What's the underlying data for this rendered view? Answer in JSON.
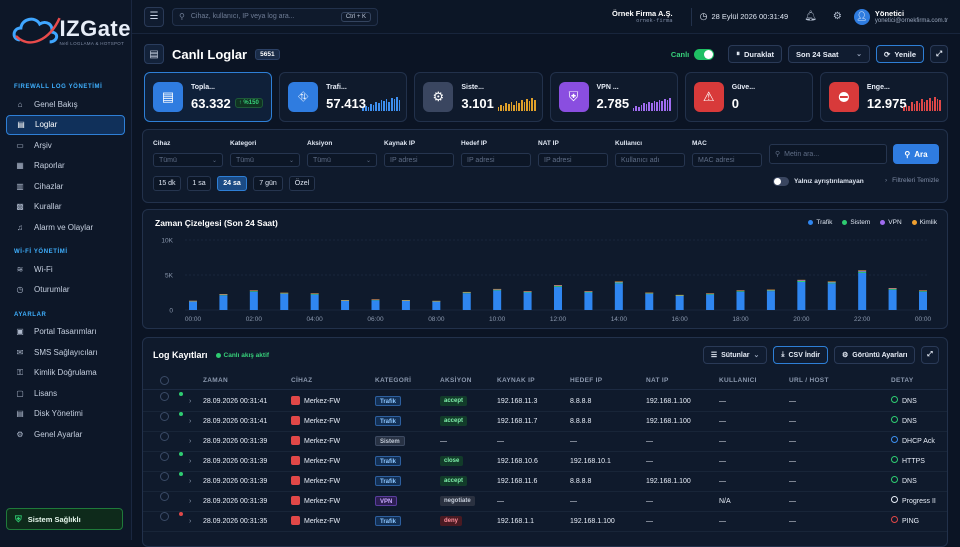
{
  "brand": {
    "name": "IZGate",
    "tagline": "Netl LOGLAMA & HOTSPOT"
  },
  "sidebar": {
    "sections": [
      {
        "title": "FIREWALL LOG YÖNETİMİ",
        "items": [
          {
            "label": "Genel Bakış",
            "icon": "home-icon",
            "active": false
          },
          {
            "label": "Loglar",
            "icon": "document-icon",
            "active": true
          },
          {
            "label": "Arşiv",
            "icon": "archive-icon",
            "active": false
          },
          {
            "label": "Raporlar",
            "icon": "report-icon",
            "active": false
          },
          {
            "label": "Cihazlar",
            "icon": "server-icon",
            "active": false
          },
          {
            "label": "Kurallar",
            "icon": "rules-icon",
            "active": false
          },
          {
            "label": "Alarm ve Olaylar",
            "icon": "bell-icon",
            "active": false
          }
        ]
      },
      {
        "title": "Wİ-Fİ YÖNETİMİ",
        "items": [
          {
            "label": "Wi-Fi",
            "icon": "wifi-icon",
            "active": false
          },
          {
            "label": "Oturumlar",
            "icon": "clock-icon",
            "active": false
          }
        ]
      },
      {
        "title": "AYARLAR",
        "items": [
          {
            "label": "Portal Tasarımları",
            "icon": "portal-icon",
            "active": false
          },
          {
            "label": "SMS Sağlayıcıları",
            "icon": "sms-icon",
            "active": false
          },
          {
            "label": "Kimlik Doğrulama",
            "icon": "key-icon",
            "active": false
          },
          {
            "label": "Lisans",
            "icon": "license-icon",
            "active": false
          },
          {
            "label": "Disk Yönetimi",
            "icon": "disk-icon",
            "active": false
          },
          {
            "label": "Genel Ayarlar",
            "icon": "gear-icon",
            "active": false
          }
        ]
      }
    ],
    "health": "Sistem Sağlıklı"
  },
  "topbar": {
    "search_placeholder": "Cihaz, kullanıcı, IP veya log ara...",
    "shortcut": "Ctrl + K",
    "company_name": "Örnek Firma A.Ş.",
    "company_domain": "ornek-firma",
    "datetime": "28 Eylül 2026 00:31:49",
    "user_name": "Yönetici",
    "user_email": "yonetici@ornekfirma.com.tr"
  },
  "page": {
    "title": "Canlı Loglar",
    "count": "5651",
    "live_label": "Canlı",
    "pause_label": "Duraklat",
    "range": "Son 24 Saat",
    "refresh_label": "Yenile"
  },
  "cards": [
    {
      "label": "Topla...",
      "value": "63.332",
      "delta": "↑ %150",
      "icon": "document-icon",
      "color": "#2f7ce0",
      "spark_color": "",
      "spark": []
    },
    {
      "label": "Trafi...",
      "value": "57.413",
      "delta": "",
      "icon": "network-icon",
      "color": "#2f7ce0",
      "spark_color": "#3d8ff0",
      "spark": [
        3,
        5,
        4,
        7,
        6,
        9,
        8,
        11,
        10,
        12,
        9,
        13,
        12,
        14,
        11
      ]
    },
    {
      "label": "Siste...",
      "value": "3.101",
      "delta": "",
      "icon": "gear-icon",
      "color": "#3a4660",
      "spark_color": "#e0a02a",
      "spark": [
        4,
        6,
        5,
        8,
        7,
        9,
        6,
        10,
        8,
        11,
        9,
        12,
        10,
        13,
        11
      ]
    },
    {
      "label": "VPN ...",
      "value": "2.785",
      "delta": "",
      "icon": "shield-icon",
      "color": "#8a4ee0",
      "spark_color": "#a06cf0",
      "spark": [
        3,
        5,
        4,
        6,
        8,
        7,
        9,
        8,
        10,
        9,
        11,
        10,
        12,
        11,
        13
      ]
    },
    {
      "label": "Güve...",
      "value": "0",
      "delta": "",
      "icon": "warning-icon",
      "color": "#d83a3a",
      "spark_color": "",
      "spark": []
    },
    {
      "label": "Enge...",
      "value": "12.975",
      "delta": "",
      "icon": "block-icon",
      "color": "#d83a3a",
      "spark_color": "#e04848",
      "spark": [
        4,
        6,
        5,
        9,
        7,
        10,
        8,
        12,
        9,
        11,
        13,
        10,
        14,
        12,
        11
      ]
    }
  ],
  "filters": {
    "fields": [
      {
        "label": "Cihaz",
        "value": "Tümü",
        "type": "select"
      },
      {
        "label": "Kategori",
        "value": "Tümü",
        "type": "select"
      },
      {
        "label": "Aksiyon",
        "value": "Tümü",
        "type": "select"
      },
      {
        "label": "Kaynak IP",
        "value": "IP adresi",
        "type": "input"
      },
      {
        "label": "Hedef IP",
        "value": "IP adresi",
        "type": "input"
      },
      {
        "label": "NAT IP",
        "value": "IP adresi",
        "type": "input"
      },
      {
        "label": "Kullanıcı",
        "value": "Kullanıcı adı",
        "type": "input"
      },
      {
        "label": "MAC",
        "value": "MAC adresi",
        "type": "input"
      }
    ],
    "text_search_placeholder": "Metin ara...",
    "search_button": "Ara",
    "quick_ranges": [
      "15 dk",
      "1 sa",
      "24 sa",
      "7 gün",
      "Özel"
    ],
    "active_range": "24 sa",
    "unparsed_label": "Yalnız ayrıştırılamayan",
    "clear_label": "Filtreleri Temizle"
  },
  "chart_data": {
    "type": "bar",
    "title": "Zaman Çizelgesi (Son 24 Saat)",
    "xlabel": "",
    "ylabel": "",
    "ylim": [
      0,
      10000
    ],
    "y_ticks": [
      "10K",
      "5K",
      "0"
    ],
    "x_ticks": [
      "00:00",
      "02:00",
      "04:00",
      "06:00",
      "08:00",
      "10:00",
      "12:00",
      "14:00",
      "16:00",
      "18:00",
      "20:00",
      "22:00",
      "00:00"
    ],
    "categories": [
      "00",
      "01",
      "02",
      "03",
      "04",
      "05",
      "06",
      "07",
      "08",
      "09",
      "10",
      "11",
      "12",
      "13",
      "14",
      "15",
      "16",
      "17",
      "18",
      "19",
      "20",
      "21",
      "22",
      "23",
      "24"
    ],
    "legend_position": "top-right",
    "series": [
      {
        "name": "Trafik",
        "color": "#2f86f0",
        "values": [
          1200,
          2100,
          2600,
          2300,
          2200,
          1300,
          1400,
          1300,
          1200,
          2400,
          2800,
          2500,
          3300,
          2500,
          3800,
          2300,
          2000,
          2200,
          2600,
          2700,
          4000,
          3800,
          5300,
          2900,
          2600
        ]
      },
      {
        "name": "Sistem",
        "color": "#2ecc71",
        "values": [
          60,
          90,
          100,
          80,
          90,
          60,
          60,
          60,
          50,
          90,
          100,
          90,
          120,
          90,
          130,
          90,
          80,
          90,
          100,
          100,
          150,
          130,
          180,
          110,
          100
        ]
      },
      {
        "name": "VPN",
        "color": "#a06cf0",
        "values": [
          40,
          60,
          70,
          60,
          60,
          40,
          40,
          40,
          40,
          60,
          70,
          60,
          80,
          60,
          90,
          60,
          50,
          60,
          70,
          70,
          100,
          90,
          120,
          80,
          70
        ]
      },
      {
        "name": "Kimlik",
        "color": "#f0a030",
        "values": [
          20,
          30,
          40,
          30,
          30,
          20,
          20,
          20,
          20,
          30,
          40,
          30,
          50,
          30,
          50,
          30,
          30,
          30,
          40,
          40,
          60,
          50,
          80,
          40,
          40
        ]
      }
    ]
  },
  "logs": {
    "title": "Log Kayıtları",
    "live_label": "Canlı akış aktif",
    "columns_btn": "Sütunlar",
    "csv_btn": "CSV İndir",
    "view_btn": "Görüntü Ayarları",
    "headers": [
      "ZAMAN",
      "CİHAZ",
      "KATEGORİ",
      "AKSİYON",
      "KAYNAK IP",
      "HEDEF IP",
      "NAT IP",
      "KULLANICI",
      "URL / HOST",
      "DETAY"
    ],
    "rows": [
      {
        "dot": "#2ecc71",
        "time": "28.09.2026 00:31:41",
        "device": "Merkez-FW",
        "category": "Trafik",
        "cat_class": "trafik",
        "action": "accept",
        "src": "192.168.11.3",
        "dst": "8.8.8.8",
        "nat": "192.168.1.100",
        "user": "—",
        "url": "—",
        "detail": "DNS",
        "detail_color": "#2ecc71"
      },
      {
        "dot": "#2ecc71",
        "time": "28.09.2026 00:31:41",
        "device": "Merkez-FW",
        "category": "Trafik",
        "cat_class": "trafik",
        "action": "accept",
        "src": "192.168.11.7",
        "dst": "8.8.8.8",
        "nat": "192.168.1.100",
        "user": "—",
        "url": "—",
        "detail": "DNS",
        "detail_color": "#2ecc71"
      },
      {
        "dot": "",
        "time": "28.09.2026 00:31:39",
        "device": "Merkez-FW",
        "category": "Sistem",
        "cat_class": "sistem",
        "action": "—",
        "src": "—",
        "dst": "—",
        "nat": "—",
        "user": "—",
        "url": "—",
        "detail": "DHCP Ack",
        "detail_color": "#3d8ff0"
      },
      {
        "dot": "#2ecc71",
        "time": "28.09.2026 00:31:39",
        "device": "Merkez-FW",
        "category": "Trafik",
        "cat_class": "trafik",
        "action": "close",
        "src": "192.168.10.6",
        "dst": "192.168.10.1",
        "nat": "—",
        "user": "—",
        "url": "—",
        "detail": "HTTPS",
        "detail_color": "#2ecc71"
      },
      {
        "dot": "#2ecc71",
        "time": "28.09.2026 00:31:39",
        "device": "Merkez-FW",
        "category": "Trafik",
        "cat_class": "trafik",
        "action": "accept",
        "src": "192.168.11.6",
        "dst": "8.8.8.8",
        "nat": "192.168.1.100",
        "user": "—",
        "url": "—",
        "detail": "DNS",
        "detail_color": "#2ecc71"
      },
      {
        "dot": "",
        "time": "28.09.2026 00:31:39",
        "device": "Merkez-FW",
        "category": "VPN",
        "cat_class": "vpn",
        "action": "negotiate",
        "src": "—",
        "dst": "—",
        "nat": "—",
        "user": "N/A",
        "url": "—",
        "detail": "Progress II",
        "detail_color": "#e6ecf6"
      },
      {
        "dot": "#e04848",
        "time": "28.09.2026 00:31:35",
        "device": "Merkez-FW",
        "category": "Trafik",
        "cat_class": "trafik",
        "action": "deny",
        "src": "192.168.1.1",
        "dst": "192.168.1.100",
        "nat": "—",
        "user": "—",
        "url": "—",
        "detail": "PING",
        "detail_color": "#e04848"
      }
    ]
  }
}
